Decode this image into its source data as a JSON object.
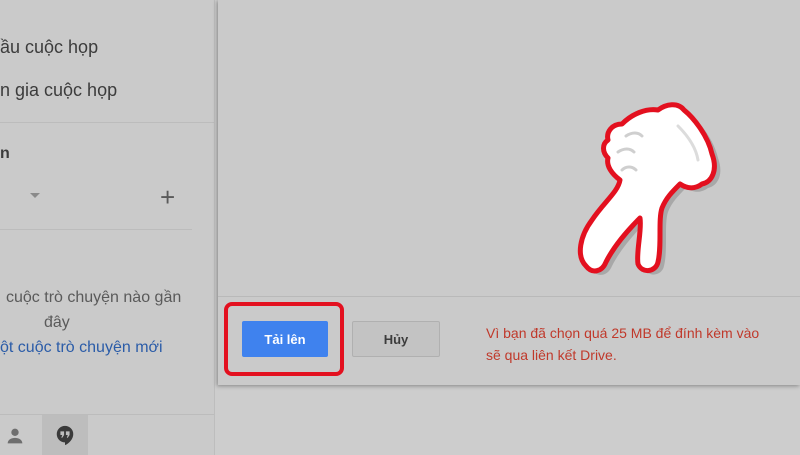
{
  "sidebar": {
    "item_start_meeting": "ầu cuộc họp",
    "item_join_meeting": "n gia cuộc họp",
    "section_heading": "n",
    "empty_line1": "cuộc trò chuyện nào gần",
    "empty_line2": "đây",
    "new_chat_link": "ột cuộc trò chuyện mới",
    "icons": [
      "plus-icon",
      "caret-down-icon",
      "person-icon",
      "hangouts-icon"
    ]
  },
  "dialog": {
    "upload_label": "Tải lên",
    "cancel_label": "Hủy",
    "warning_line1": "Vì bạn đã chọn quá 25 MB để đính kèm vào",
    "warning_line2": "sẽ qua liên kết Drive."
  },
  "colors": {
    "upload_button": "#3f82ee",
    "highlight": "#e3101f",
    "warning_text": "#c0392b",
    "link": "#2b5ca8"
  }
}
